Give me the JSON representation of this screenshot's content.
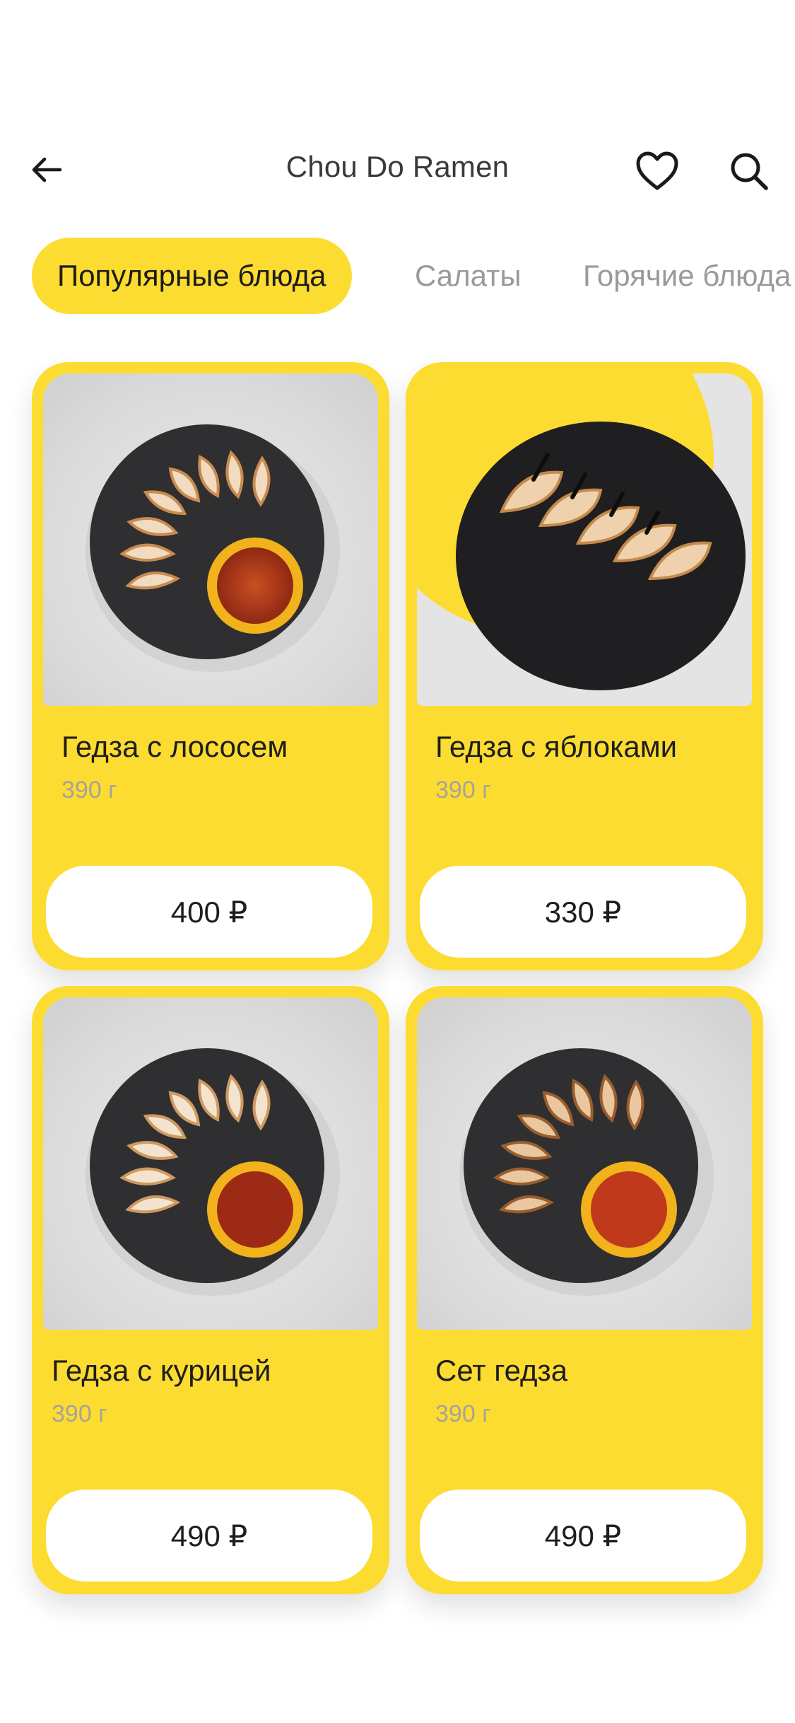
{
  "header": {
    "title": "Chou Do Ramen",
    "back_icon": "arrow-left-icon",
    "favorite_icon": "heart-icon",
    "search_icon": "search-icon"
  },
  "tabs": [
    {
      "label": "Популярные блюда",
      "active": true
    },
    {
      "label": "Салаты",
      "active": false
    },
    {
      "label": "Горячие блюда",
      "active": false
    }
  ],
  "products": [
    {
      "name": "Гедза с лососем",
      "weight": "390 г",
      "price": "400 ₽"
    },
    {
      "name": "Гедза с яблоками",
      "weight": "390 г",
      "price": "330 ₽"
    },
    {
      "name": "Гедза с курицей",
      "weight": "390 г",
      "price": "490 ₽"
    },
    {
      "name": "Сет гедза",
      "weight": "390 г",
      "price": "490 ₽"
    }
  ],
  "colors": {
    "accent": "#fddc32",
    "text_primary": "#1e1e1e",
    "text_secondary": "#a8a29b",
    "tab_inactive": "#9a9a9a"
  }
}
